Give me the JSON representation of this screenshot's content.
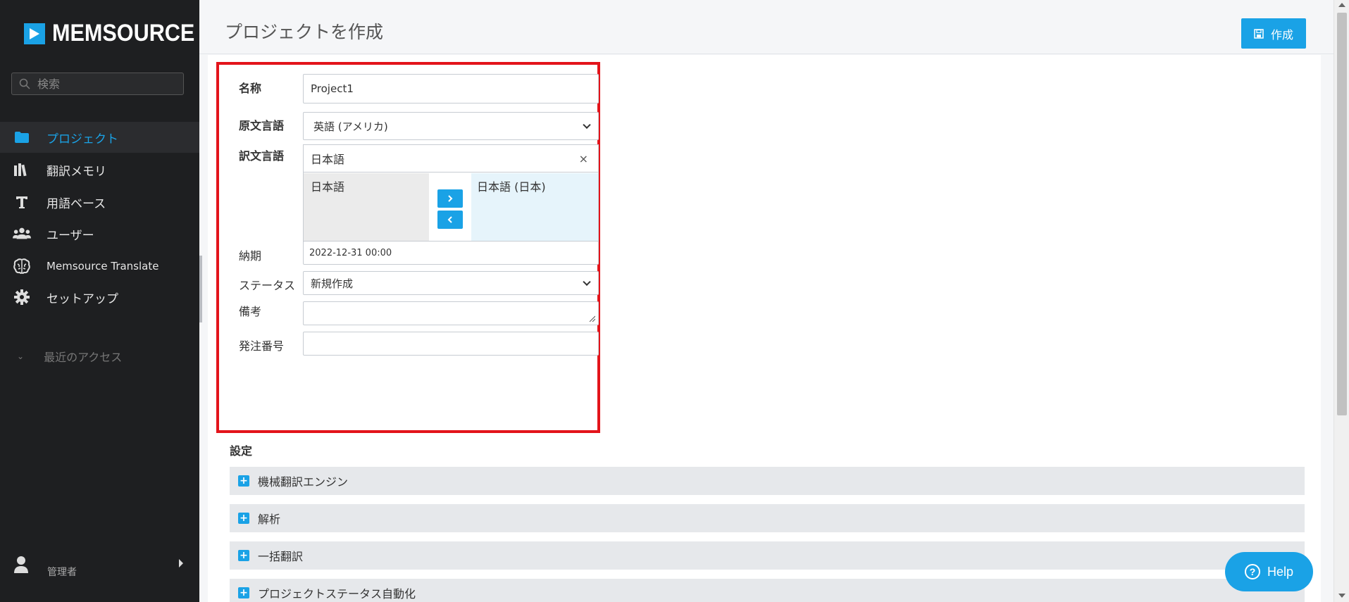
{
  "app": {
    "brand": "MEMSOURCE",
    "accent_color": "#1aa2e6",
    "highlight_color": "#e3141b"
  },
  "sidebar": {
    "search": {
      "placeholder": "検索",
      "icon": "search-icon"
    },
    "items": [
      {
        "label": "プロジェクト",
        "icon": "folder-icon",
        "active": true
      },
      {
        "label": "翻訳メモリ",
        "icon": "books-icon",
        "active": false
      },
      {
        "label": "用語ベース",
        "icon": "text-t-icon",
        "active": false
      },
      {
        "label": "ユーザー",
        "icon": "users-icon",
        "active": false
      },
      {
        "label": "Memsource Translate",
        "icon": "brain-icon",
        "active": false
      },
      {
        "label": "セットアップ",
        "icon": "gear-icon",
        "active": false
      }
    ],
    "recent_label": "最近のアクセス",
    "user": {
      "name": "",
      "role": "管理者",
      "icon": "user-icon"
    }
  },
  "header": {
    "title": "プロジェクトを作成",
    "create_label": "作成",
    "create_icon": "save-icon"
  },
  "form": {
    "name": {
      "label": "名称",
      "value": "Project1"
    },
    "source_lang": {
      "label": "原文言語",
      "value": "英語 (アメリカ)"
    },
    "target_lang": {
      "label": "訳文言語",
      "selected": "日本語",
      "clear": "×",
      "available": [
        "日本語"
      ],
      "chosen": [
        "日本語 (日本)"
      ]
    },
    "due_date": {
      "label": "納期",
      "value": "2022-12-31 00:00"
    },
    "status": {
      "label": "ステータス",
      "value": "新規作成"
    },
    "note": {
      "label": "備考",
      "value": ""
    },
    "po_number": {
      "label": "発注番号",
      "value": ""
    }
  },
  "settings": {
    "title": "設定",
    "sections": [
      "機械翻訳エンジン",
      "解析",
      "一括翻訳",
      "プロジェクトステータス自動化"
    ]
  },
  "help": {
    "label": "Help"
  }
}
